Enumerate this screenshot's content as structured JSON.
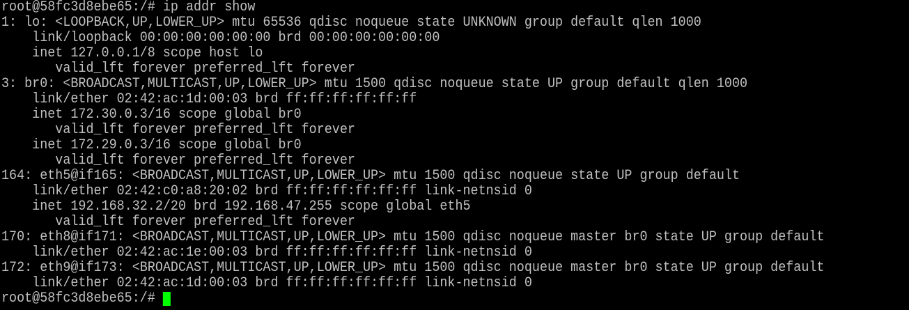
{
  "terminal": {
    "prompt": "root@58fc3d8ebe65:/# ",
    "command": "ip addr show",
    "cursor_color": "#00ff00",
    "lines": [
      "1: lo: <LOOPBACK,UP,LOWER_UP> mtu 65536 qdisc noqueue state UNKNOWN group default qlen 1000",
      "    link/loopback 00:00:00:00:00:00 brd 00:00:00:00:00:00",
      "    inet 127.0.0.1/8 scope host lo",
      "       valid_lft forever preferred_lft forever",
      "3: br0: <BROADCAST,MULTICAST,UP,LOWER_UP> mtu 1500 qdisc noqueue state UP group default qlen 1000",
      "    link/ether 02:42:ac:1d:00:03 brd ff:ff:ff:ff:ff:ff",
      "    inet 172.30.0.3/16 scope global br0",
      "       valid_lft forever preferred_lft forever",
      "    inet 172.29.0.3/16 scope global br0",
      "       valid_lft forever preferred_lft forever",
      "164: eth5@if165: <BROADCAST,MULTICAST,UP,LOWER_UP> mtu 1500 qdisc noqueue state UP group default",
      "    link/ether 02:42:c0:a8:20:02 brd ff:ff:ff:ff:ff:ff link-netnsid 0",
      "    inet 192.168.32.2/20 brd 192.168.47.255 scope global eth5",
      "       valid_lft forever preferred_lft forever",
      "170: eth8@if171: <BROADCAST,MULTICAST,UP,LOWER_UP> mtu 1500 qdisc noqueue master br0 state UP group default",
      "    link/ether 02:42:ac:1e:00:03 brd ff:ff:ff:ff:ff:ff link-netnsid 0",
      "172: eth9@if173: <BROADCAST,MULTICAST,UP,LOWER_UP> mtu 1500 qdisc noqueue master br0 state UP group default",
      "    link/ether 02:42:ac:1d:00:03 brd ff:ff:ff:ff:ff:ff link-netnsid 0"
    ]
  }
}
